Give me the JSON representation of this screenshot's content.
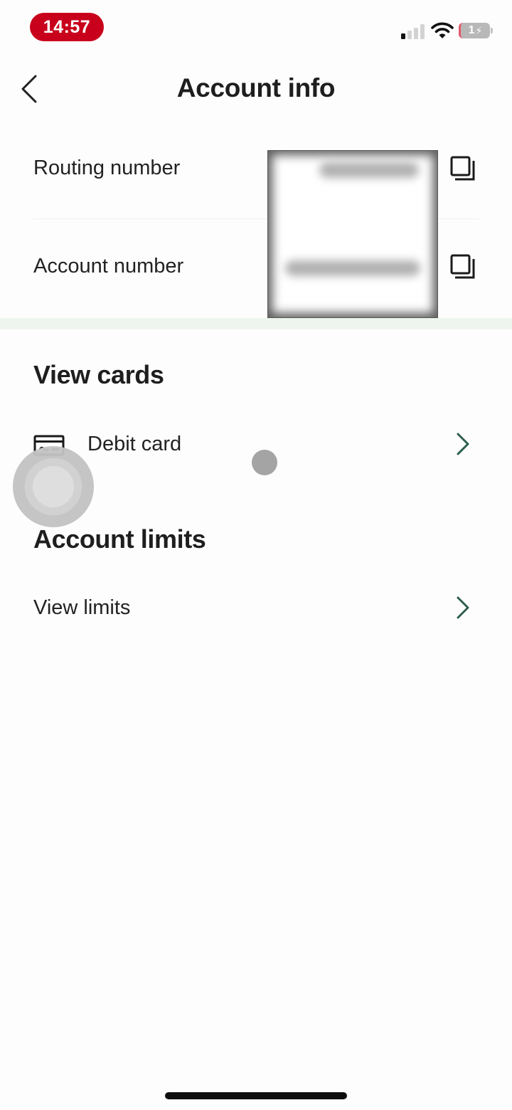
{
  "status_bar": {
    "time": "14:57",
    "signal_bars_active": 1,
    "signal_bars_total": 4,
    "battery_label": "1",
    "battery_charging": true,
    "time_pill_color": "#c8001b"
  },
  "header": {
    "title": "Account info",
    "back_icon": "chevron-left-icon"
  },
  "account_info": {
    "rows": [
      {
        "label": "Routing number",
        "value": "[redacted]",
        "copy_icon": "copy-icon"
      },
      {
        "label": "Account number",
        "value": "[redacted]",
        "copy_icon": "copy-icon"
      }
    ]
  },
  "sections": {
    "cards": {
      "heading": "View cards",
      "items": [
        {
          "label": "Debit card",
          "icon": "credit-card-icon",
          "chevron": "chevron-right-icon"
        }
      ]
    },
    "limits": {
      "heading": "Account limits",
      "items": [
        {
          "label": "View limits",
          "chevron": "chevron-right-icon"
        }
      ]
    }
  },
  "colors": {
    "accent_chevron": "#2e5e4e",
    "section_band": "#eef4ee",
    "text": "#1e1e1e"
  }
}
